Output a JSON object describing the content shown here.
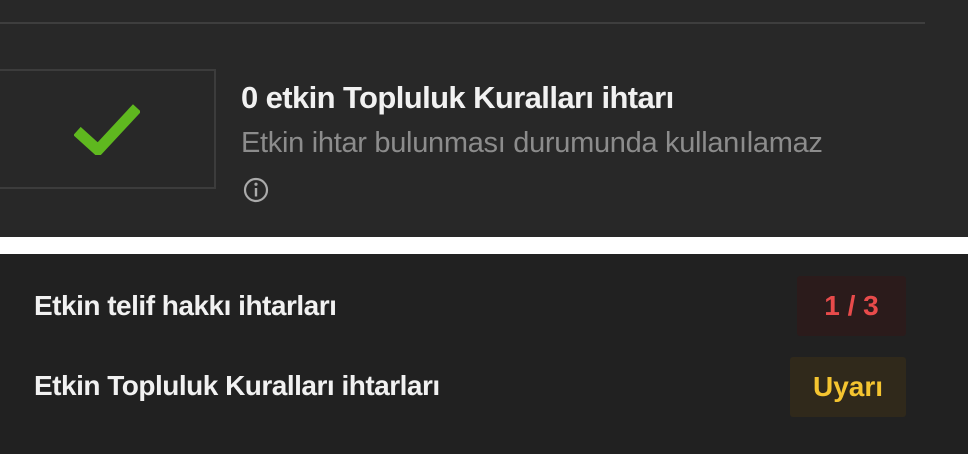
{
  "community_guidelines_status": {
    "title": "0 etkin Topluluk Kuralları ihtarı",
    "subtitle": "Etkin ihtar bulunması durumunda kullanılamaz",
    "status_icon": "checkmark-icon",
    "info_icon": "info-icon",
    "check_color": "#5fb81f"
  },
  "strikes": {
    "copyright": {
      "label": "Etkin telif hakkı ihtarları",
      "value": "1 / 3",
      "color": "#e84b4b"
    },
    "community": {
      "label": "Etkin Topluluk Kuralları ihtarları",
      "value": "Uyarı",
      "color": "#f4c430"
    }
  }
}
